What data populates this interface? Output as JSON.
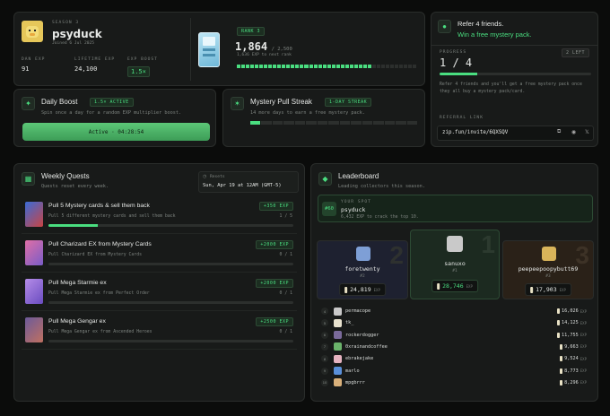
{
  "profile": {
    "season": "SEASON 3",
    "username": "psyduck",
    "joined": "Joined 6 Jul 2025",
    "stats": [
      {
        "label": "DAN EXP",
        "value": "91"
      },
      {
        "label": "LIFETIME EXP",
        "value": "24,100"
      },
      {
        "label": "EXP BOOST",
        "value": "1.5×"
      }
    ],
    "rank_label": "RANK 3",
    "exp_current": "1,864",
    "exp_total": "/ 2,500",
    "exp_note": "1,636 EXP to next rank",
    "exp_progress": 0.75
  },
  "referral": {
    "title": "Refer 4 friends.",
    "subtitle": "Win a free mystery pack.",
    "progress_label": "PROGRESS",
    "left_badge": "2 LEFT",
    "progress_value": "1 / 4",
    "progress_fraction": 0.25,
    "description": "Refer 4 friends and you'll get a free mystery pack once they all buy a mystery pack/card.",
    "link_label": "REFERRAL LINK",
    "link": "zip.fun/invite/6QXSQV",
    "icons": [
      "copy-icon",
      "reddit-icon",
      "x-icon"
    ]
  },
  "daily_boost": {
    "title": "Daily Boost",
    "badge": "1.5× ACTIVE",
    "description": "Spin once a day for a random EXP multiplier boost.",
    "button": "Active · 04:28:54"
  },
  "streak": {
    "title": "Mystery Pull Streak",
    "badge": "1-DAY STREAK",
    "description": "14 more days to earn a free mystery pack.",
    "days_done": 1,
    "days_total": 15
  },
  "quests": {
    "title": "Weekly Quests",
    "subtitle": "Quests reset every week.",
    "resets_label": "Resets",
    "resets_value": "Sun, Apr 19 at 12AM (GMT-5)",
    "items": [
      {
        "title": "Pull 5 Mystery cards & sell them back",
        "desc": "Pull 5 different mystery cards and sell them back",
        "reward": "+350 EXP",
        "count": "1 / 5",
        "progress": 0.2
      },
      {
        "title": "Pull Charizard EX from Mystery Cards",
        "desc": "Pull Charizard EX from Mystery Cards",
        "reward": "+2000 EXP",
        "count": "0 / 1",
        "progress": 0
      },
      {
        "title": "Pull Mega Starmie ex",
        "desc": "Pull Mega Starmie ex from Perfect Order",
        "reward": "+2000 EXP",
        "count": "0 / 1",
        "progress": 0
      },
      {
        "title": "Pull Mega Gengar ex",
        "desc": "Pull Mega Gengar ex from Ascended Heroes",
        "reward": "+2500 EXP",
        "count": "0 / 1",
        "progress": 0
      }
    ]
  },
  "leaderboard": {
    "title": "Leaderboard",
    "subtitle": "Leading collectors this season.",
    "your_spot": {
      "label": "YOUR SPOT",
      "rank": "#60",
      "name": "psyduck",
      "note": "6,432 EXP to crack the top 10."
    },
    "podium": [
      {
        "place": "2",
        "name": "foretwenty",
        "tag": "#2",
        "exp": "24,819",
        "unit": "EXP"
      },
      {
        "place": "1",
        "name": "sanuxo",
        "tag": "#1",
        "exp": "28,746",
        "unit": "EXP"
      },
      {
        "place": "3",
        "name": "peepeepoopybutt69",
        "tag": "#3",
        "exp": "17,903",
        "unit": "EXP"
      }
    ],
    "rows": [
      {
        "rank": "4",
        "name": "permacope",
        "exp": "16,026"
      },
      {
        "rank": "5",
        "name": "tk_",
        "exp": "14,125"
      },
      {
        "rank": "6",
        "name": "rockerdogger",
        "exp": "11,755"
      },
      {
        "rank": "7",
        "name": "0xrainandcoffee",
        "exp": "9,663"
      },
      {
        "rank": "8",
        "name": "ebrakejake",
        "exp": "9,524"
      },
      {
        "rank": "9",
        "name": "marlo",
        "exp": "8,773"
      },
      {
        "rank": "10",
        "name": "mpgbrrr",
        "exp": "8,296"
      }
    ],
    "unit": "EXP"
  },
  "colors": {
    "accent": "#4ade80",
    "background": "#0b0c0b",
    "card": "#181a19"
  }
}
